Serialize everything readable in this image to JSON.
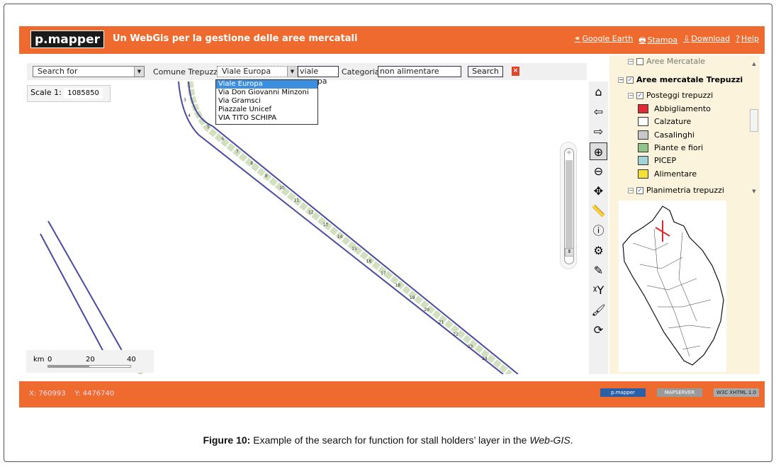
{
  "header": {
    "logo": "p.mapper",
    "title": "Un WebGis per la gestione delle aree mercatali",
    "links": [
      {
        "icon": "google-earth-icon",
        "glyph": "⚭",
        "label": "Google Earth"
      },
      {
        "icon": "print-icon",
        "glyph": "🖶",
        "label": "Stampa"
      },
      {
        "icon": "download-icon",
        "glyph": "⇩",
        "label": "Download"
      },
      {
        "icon": "help-icon",
        "glyph": "?",
        "label": "Help"
      }
    ]
  },
  "search": {
    "search_for": "Search for",
    "comune_label": "Comune Trepuzzi",
    "street_value": "Viale Europa",
    "street_text": "viale europa",
    "categoria_label": "Categoria",
    "categoria_value": "non alimentare",
    "search_button": "Search",
    "options": [
      "Viale Europa",
      "Via Don Giovanni Minzoni",
      "Via Gramsci",
      "Piazzale Unicef",
      "VIA TITO SCHIPA"
    ]
  },
  "map": {
    "scale_label": "Scale 1:",
    "scale_value": "1085850",
    "scalebar": {
      "unit": "km",
      "ticks": [
        "0",
        "20",
        "40"
      ]
    },
    "segment_labels": [
      "3",
      "4",
      "5",
      "6",
      "7",
      "8",
      "9",
      "10",
      "11",
      "12",
      "13",
      "14",
      "15",
      "16",
      "17",
      "18",
      "19",
      "20",
      "21",
      "22",
      "23",
      "24"
    ]
  },
  "tools": [
    {
      "name": "home-icon",
      "glyph": "⌂"
    },
    {
      "name": "back-icon",
      "glyph": "⇦"
    },
    {
      "name": "forward-icon",
      "glyph": "⇨"
    },
    {
      "name": "zoom-in-icon",
      "glyph": "⊕",
      "active": true
    },
    {
      "name": "zoom-out-icon",
      "glyph": "⊖"
    },
    {
      "name": "pan-icon",
      "glyph": "✥"
    },
    {
      "name": "measure-icon",
      "glyph": "📏"
    },
    {
      "name": "identify-icon",
      "glyph": "ⓘ"
    },
    {
      "name": "select-icon",
      "glyph": "⚙"
    },
    {
      "name": "draw-icon",
      "glyph": "✎"
    },
    {
      "name": "coordinates-icon",
      "glyph": "ᵡY"
    },
    {
      "name": "paint-icon",
      "glyph": "🖌"
    },
    {
      "name": "refresh-icon",
      "glyph": "⟳"
    }
  ],
  "toc": {
    "top_group": "Aree Mercatale",
    "group": "Aree mercatale Trepuzzi",
    "layer": "Posteggi trepuzzi",
    "legend": [
      {
        "label": "Abbigliamento",
        "color": "#e02a35"
      },
      {
        "label": "Calzature",
        "color": "#ffffff"
      },
      {
        "label": "Casalinghi",
        "color": "#c8c8c8"
      },
      {
        "label": "Piante e fiori",
        "color": "#92c48a"
      },
      {
        "label": "PICEP",
        "color": "#a5d4d8"
      },
      {
        "label": "Alimentare",
        "color": "#f5e03a"
      }
    ],
    "layer2": "Planimetria trepuzzi"
  },
  "footer": {
    "x_label": "X:",
    "x_value": "760993",
    "y_label": "Y:",
    "y_value": "4476740",
    "badges": [
      "p.mapper",
      "MAPSERVER",
      "W3C XHTML 1.0"
    ]
  },
  "caption": {
    "bold": "Figure 10:",
    "text": " Example of the search for function for stall holders’ layer in the ",
    "italic": "Web-GIS",
    "end": "."
  },
  "colors": {
    "accent": "#ee6a2e",
    "road": "#4a4aa0"
  }
}
